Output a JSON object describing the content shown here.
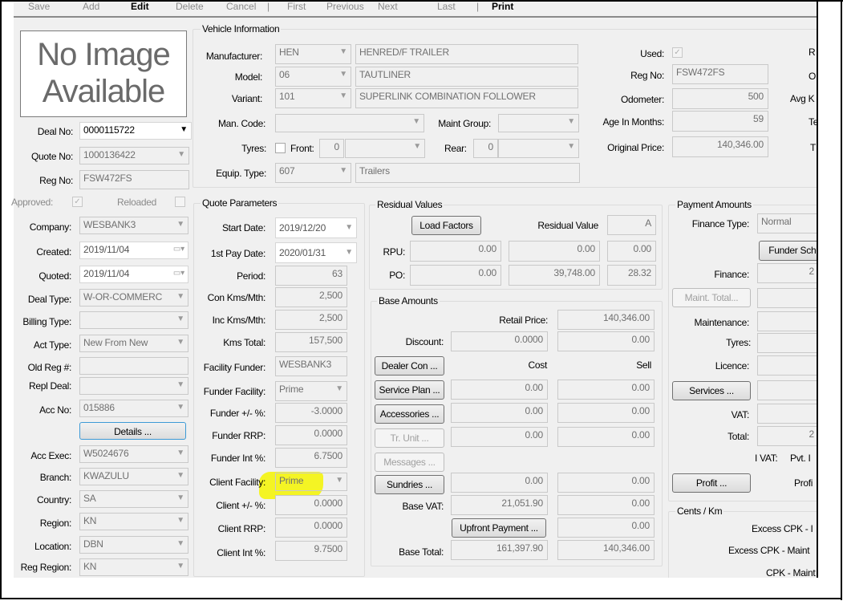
{
  "toolbar": {
    "items": [
      "Save",
      "Add",
      "Edit",
      "Delete",
      "Cancel",
      "|",
      "First",
      "Previous",
      "Next",
      "Last",
      "|",
      "Print"
    ]
  },
  "image_placeholder": {
    "line1": "No Image",
    "line2": "Available"
  },
  "left": {
    "deal_no": {
      "label": "Deal No:",
      "value": "0000115722"
    },
    "quote_no": {
      "label": "Quote No:",
      "value": "1000136422"
    },
    "reg_no": {
      "label": "Reg No:",
      "value": "FSW472FS"
    },
    "approved": {
      "label": "Approved:",
      "checked": true
    },
    "reloaded": {
      "label": "Reloaded",
      "checked": false
    },
    "company": {
      "label": "Company:",
      "value": "WESBANK3"
    },
    "created": {
      "label": "Created:",
      "value": "2019/11/04"
    },
    "quoted": {
      "label": "Quoted:",
      "value": "2019/11/04"
    },
    "deal_type": {
      "label": "Deal Type:",
      "value": "W-OR-COMMERC"
    },
    "billing_type": {
      "label": "Billing Type:",
      "value": ""
    },
    "act_type": {
      "label": "Act Type:",
      "value": "New From New"
    },
    "old_reg": {
      "label": "Old Reg #:",
      "value": ""
    },
    "repl_deal": {
      "label": "Repl Deal:",
      "value": ""
    },
    "acc_no": {
      "label": "Acc No:",
      "value": "015886"
    },
    "details_button": "Details ...",
    "acc_exec": {
      "label": "Acc Exec:",
      "value": "W5024676"
    },
    "branch": {
      "label": "Branch:",
      "value": "KWAZULU"
    },
    "country": {
      "label": "Country:",
      "value": "SA"
    },
    "region": {
      "label": "Region:",
      "value": "KN"
    },
    "location": {
      "label": "Location:",
      "value": "DBN"
    },
    "reg_region": {
      "label": "Reg Region:",
      "value": "KN"
    }
  },
  "vehicle": {
    "title": "Vehicle Information",
    "manufacturer": {
      "label": "Manufacturer:",
      "code": "HEN",
      "name": "HENRED/F TRAILER"
    },
    "model": {
      "label": "Model:",
      "code": "06",
      "name": "TAUTLINER"
    },
    "variant": {
      "label": "Variant:",
      "code": "101",
      "name": "SUPERLINK COMBINATION FOLLOWER"
    },
    "man_code": {
      "label": "Man. Code:",
      "value": ""
    },
    "maint_group": {
      "label": "Maint Group:",
      "value": ""
    },
    "tyres": {
      "label": "Tyres:",
      "front_label": "Front:",
      "front": "0",
      "rear_label": "Rear:",
      "rear": "0"
    },
    "equip_type": {
      "label": "Equip. Type:",
      "code": "607",
      "name": "Trailers"
    },
    "used": {
      "label": "Used:",
      "checked": true
    },
    "reg_no": {
      "label": "Reg No:",
      "value": "FSW472FS"
    },
    "odometer": {
      "label": "Odometer:",
      "value": "500"
    },
    "age": {
      "label": "Age In Months:",
      "value": "59"
    },
    "original_price": {
      "label": "Original Price:",
      "value": "140,346.00"
    },
    "cut_labels": [
      "R",
      "O",
      "Avg K",
      "Te",
      "T"
    ]
  },
  "quote": {
    "title": "Quote Parameters",
    "start_date": {
      "label": "Start Date:",
      "value": "2019/12/20"
    },
    "first_pay": {
      "label": "1st Pay Date:",
      "value": "2020/01/31"
    },
    "period": {
      "label": "Period:",
      "value": "63"
    },
    "con_kms": {
      "label": "Con Kms/Mth:",
      "value": "2,500"
    },
    "inc_kms": {
      "label": "Inc Kms/Mth:",
      "value": "2,500"
    },
    "kms_total": {
      "label": "Kms Total:",
      "value": "157,500"
    },
    "facility_funder": {
      "label": "Facility Funder:",
      "value": "WESBANK3"
    },
    "funder_facility": {
      "label": "Funder Facility:",
      "value": "Prime"
    },
    "funder_pm": {
      "label": "Funder +/- %:",
      "value": "-3.0000"
    },
    "funder_rrp": {
      "label": "Funder RRP:",
      "value": "0.0000"
    },
    "funder_int": {
      "label": "Funder Int %:",
      "value": "6.7500"
    },
    "client_facility": {
      "label": "Client Facility:",
      "value": "Prime"
    },
    "client_pm": {
      "label": "Client +/- %:",
      "value": "0.0000"
    },
    "client_rrp": {
      "label": "Client RRP:",
      "value": "0.0000"
    },
    "client_int": {
      "label": "Client Int %:",
      "value": "9.7500"
    }
  },
  "residual": {
    "title": "Residual Values",
    "load_factors": "Load Factors",
    "rv_label": "Residual Value",
    "rv_value": "A",
    "rpu": {
      "label": "RPU:",
      "values": [
        "0.00",
        "0.00",
        "0.00"
      ]
    },
    "po": {
      "label": "PO:",
      "values": [
        "0.00",
        "39,748.00",
        "28.32"
      ]
    }
  },
  "base": {
    "title": "Base Amounts",
    "retail_label": "Retail Price:",
    "retail": "140,346.00",
    "discount_label": "Discount:",
    "discount_pct": "0.0000",
    "discount": "0.00",
    "dealer_con": "Dealer Con ...",
    "cost_header": "Cost",
    "sell_header": "Sell",
    "service_plan": {
      "label": "Service Plan ...",
      "cost": "0.00",
      "sell": "0.00"
    },
    "accessories": {
      "label": "Accessories ...",
      "cost": "0.00",
      "sell": "0.00"
    },
    "tr_unit": {
      "label": "Tr. Unit ...",
      "cost": "0.00",
      "sell": "0.00"
    },
    "messages": "Messages ...",
    "sundries": {
      "label": "Sundries ...",
      "cost": "0.00",
      "sell": "0.00"
    },
    "base_vat": {
      "label": "Base VAT:",
      "cost": "21,051.90",
      "sell": "0.00"
    },
    "upfront": {
      "label": "Upfront Payment ...",
      "sell": "0.00"
    },
    "base_total": {
      "label": "Base Total:",
      "cost": "161,397.90",
      "sell": "140,346.00"
    }
  },
  "payment": {
    "title": "Payment Amounts",
    "finance_type": {
      "label": "Finance Type:",
      "value": "Normal"
    },
    "funder_schedule": "Funder Sche",
    "finance": {
      "label": "Finance:",
      "value": "2"
    },
    "maint_total": "Maint. Total...",
    "maintenance": "Maintenance:",
    "tyres": "Tyres:",
    "licence": "Licence:",
    "services": "Services ...",
    "vat": "VAT:",
    "total": {
      "label": "Total:",
      "value": "2"
    },
    "ivat": "I VAT:",
    "pvt": "Pvt. I",
    "profit_button": "Profit ...",
    "profit_label": "Profi"
  },
  "cents": {
    "title": "Cents / Km",
    "rows": [
      "Excess CPK - I",
      "Excess CPK - Maint",
      "CPK - Maint"
    ]
  }
}
